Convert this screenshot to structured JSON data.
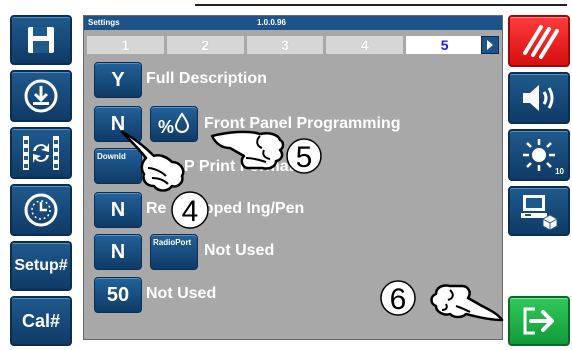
{
  "window": {
    "title": "Settings",
    "version": "1.0.0.96"
  },
  "tabs": [
    "1",
    "2",
    "3",
    "4",
    "5"
  ],
  "active_tab": "5",
  "left_sidebar": {
    "setup_label": "Setup#",
    "cal_label": "Cal#"
  },
  "right_sidebar": {
    "brightness_level": "10"
  },
  "settings": [
    {
      "value": "Y",
      "label": "Full Description"
    },
    {
      "value": "N",
      "button": "%⁰",
      "label": "Front Panel Programming"
    },
    {
      "value": "Downld",
      "label": "P Print Format"
    },
    {
      "value": "N",
      "label": "Re   Skipped Ing/Pen"
    },
    {
      "value": "N",
      "button": "RadioPort",
      "label": "Not Used"
    },
    {
      "value": "50",
      "label": "Not Used"
    }
  ],
  "callouts": [
    "4",
    "5",
    "6"
  ],
  "colors": {
    "button_blue": "#1f5a8d",
    "panel_gray": "#a8a8a8",
    "title_blue": "#1e5389",
    "cancel_red": "#e01515",
    "enter_green": "#1fae45",
    "active_tab_text": "#1a1aff"
  }
}
